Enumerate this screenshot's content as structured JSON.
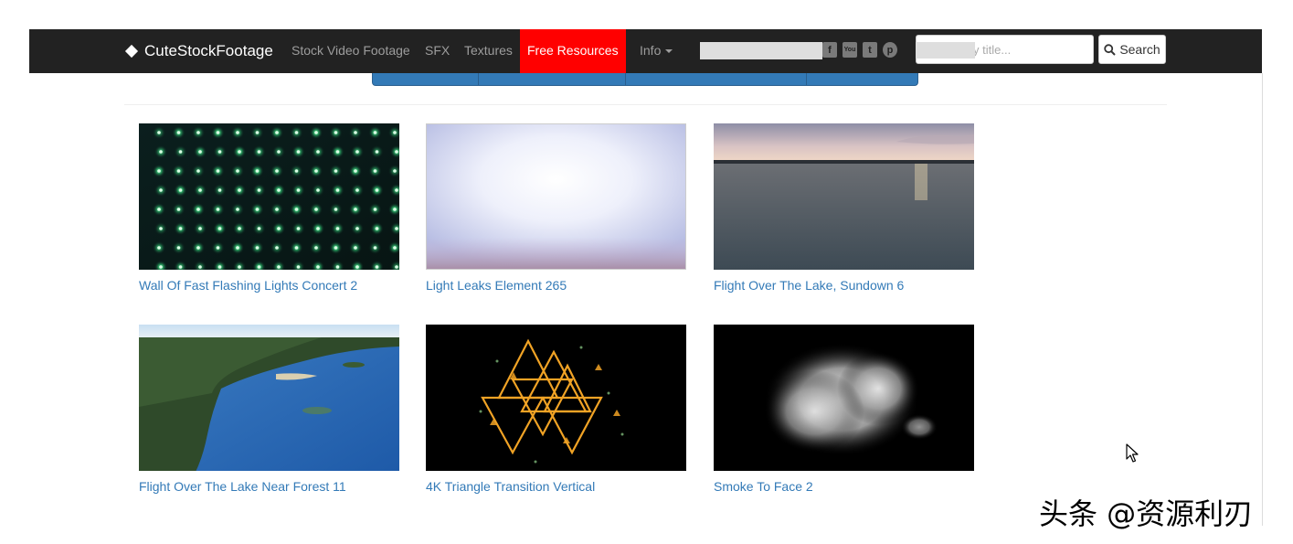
{
  "navbar": {
    "brand": "CuteStockFootage",
    "links": [
      "Stock Video Footage",
      "SFX",
      "Textures",
      "Free Resources",
      "Info"
    ],
    "active_link": "Free Resources",
    "social_icons": [
      "facebook-icon",
      "youtube-icon",
      "twitter-icon",
      "pinterest-icon"
    ],
    "search": {
      "placeholder": "Search by title...",
      "button_label": "Search"
    }
  },
  "colors": {
    "navbar_bg": "#222222",
    "active_bg": "#ff0000",
    "link": "#337ab7"
  },
  "videos": [
    {
      "title": "Wall Of Fast Flashing Lights Concert 2"
    },
    {
      "title": "Light Leaks Element 265"
    },
    {
      "title": "Flight Over The Lake, Sundown 6"
    },
    {
      "title": "Flight Over The Lake Near Forest 11"
    },
    {
      "title": "4K Triangle Transition Vertical"
    },
    {
      "title": "Smoke To Face 2"
    }
  ],
  "watermark": "头条 @资源利刃"
}
